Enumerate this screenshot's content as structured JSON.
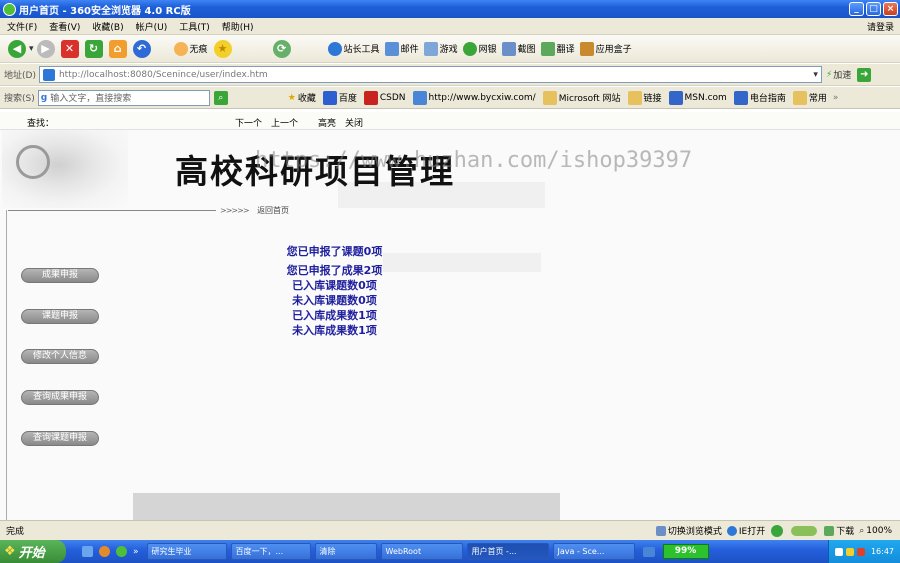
{
  "window": {
    "title": "用户首页 - 360安全浏览器 4.0 RC版"
  },
  "menu": {
    "items": [
      "文件(F)",
      "查看(V)",
      "收藏(B)",
      "帐户(U)",
      "工具(T)",
      "帮助(H)"
    ],
    "login": "请登录"
  },
  "toolbar": {
    "no_image": "无痕",
    "items": [
      "站长工具",
      "邮件",
      "游戏",
      "网银",
      "截图",
      "翻译",
      "应用盒子"
    ]
  },
  "address": {
    "label": "地址(D)",
    "url": "http://localhost:8080/Scenince/user/index.htm",
    "go": "加速"
  },
  "favbar": {
    "label": "搜索(S)",
    "search_placeholder": "输入文字，直接搜索",
    "items": [
      "收藏",
      "百度",
      "CSDN",
      "http://www.bycxiw.com/",
      "Microsoft 网站",
      "链接",
      "MSN.com",
      "电台指南",
      "常用"
    ]
  },
  "findbar": {
    "label": "查找：",
    "next": "下一个",
    "prev": "上一个",
    "highlight": "高亮",
    "close": "关闭"
  },
  "page": {
    "title": "高校科研项目管理",
    "watermark": "https://www.huzhan.com/ishop39397",
    "back_home": "返回首页",
    "back_chevrons": ">>>>>",
    "sidebar": [
      "成果申报",
      "课题申报",
      "修改个人信息",
      "查询成果申报",
      "查询课题申报"
    ],
    "stats": [
      "您已申报了课题0项",
      "您已申报了成果2项",
      "已入库课题数0项",
      "未入库课题数0项",
      "已入库成果数1项",
      "未入库成果数1项"
    ]
  },
  "status": {
    "text": "完成",
    "switch_mode": "切换浏览模式",
    "speed": "IE打开",
    "download": "下载",
    "zoom": "100%"
  },
  "taskbar": {
    "start": "开始",
    "tasks": [
      "研究生毕业",
      "百度一下，...",
      "清除",
      "WebRoot",
      "用户首页 -...",
      "Java - Sce..."
    ],
    "battery": "99%",
    "clock": "16:47"
  }
}
